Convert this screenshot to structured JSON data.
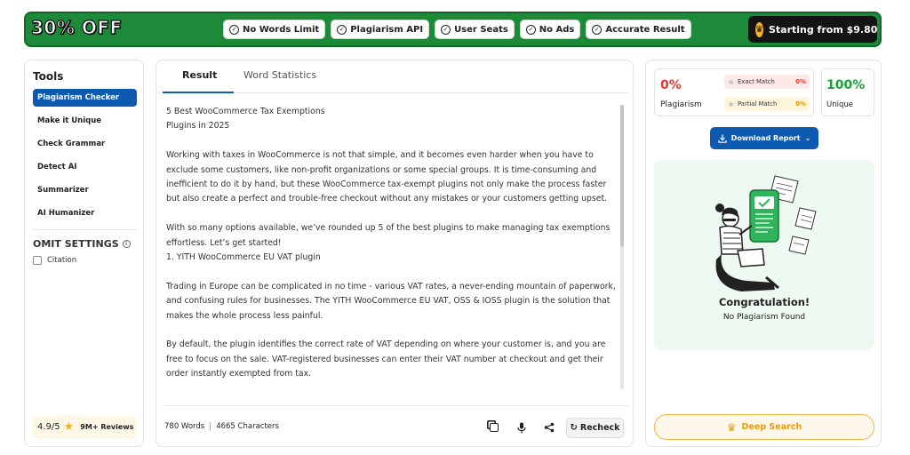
{
  "banner": {
    "discount": "30% OFF",
    "features": [
      "No Words Limit",
      "Plagiarism API",
      "User Seats",
      "No Ads",
      "Accurate Result"
    ],
    "promo": "Starting from $9.80"
  },
  "sidebar": {
    "title": "Tools",
    "items": [
      {
        "label": "Plagiarism Checker",
        "active": true
      },
      {
        "label": "Make it Unique",
        "active": false
      },
      {
        "label": "Check Grammar",
        "active": false
      },
      {
        "label": "Detect AI",
        "active": false
      },
      {
        "label": "Summarizer",
        "active": false
      },
      {
        "label": "AI Humanizer",
        "active": false
      }
    ],
    "omit_title": "OMIT SETTINGS",
    "citation_label": "Citation",
    "rating_score": "4.9/5",
    "rating_reviews": "9M+ Reviews"
  },
  "editor": {
    "tabs": [
      "Result",
      "Word Statistics"
    ],
    "active_tab": "Result",
    "paragraphs": [
      "5 Best WooCommerce Tax Exemptions Plugins in 2025",
      "Working with taxes in WooCommerce is not that simple, and it becomes even harder when you have to exclude some customers, like non-profit organizations or some special groups. It is time-consuming and inefficient to do it by hand, but these WooCommerce tax-exempt plugins not only make the process faster but also create a perfect and trouble-free checkout without any mistakes or your customers getting upset.",
      "With so many options available, we’ve rounded up 5 of the best plugins to make managing tax exemptions effortless. Let’s get started!",
      "1. YITH WooCommerce EU VAT plugin",
      "Trading in Europe can be complicated in no time - various VAT rates, a never-ending mountain of paperwork, and confusing rules for businesses. The YITH WooCommerce EU VAT, OSS & IOSS plugin is the solution that makes the whole process less painful.",
      "By default, the plugin identifies the correct rate of VAT depending on where your customer is, and you are free to focus on the sale. VAT-registered businesses can enter their VAT number at checkout and get their order instantly exempted from tax."
    ],
    "word_count": "780 Words",
    "char_count": "4665 Characters",
    "recheck_label": "Recheck"
  },
  "results": {
    "plagiarism_pct": "0%",
    "plagiarism_label": "Plagiarism",
    "exact_label": "Exact Match",
    "exact_value": "0%",
    "partial_label": "Partial Match",
    "partial_value": "0%",
    "unique_pct": "100%",
    "unique_label": "Unique",
    "download_label": "Download Report",
    "congrats_title": "Congratulation!",
    "congrats_sub": "No Plagiarism Found",
    "deep_search_label": "Deep Search"
  },
  "colors": {
    "banner_green": "#1d8a3a",
    "accent_blue": "#0d5bb0",
    "plagiarism_red": "#e53935",
    "unique_green": "#1f9e3c",
    "deep_search_orange": "#e89a12"
  }
}
